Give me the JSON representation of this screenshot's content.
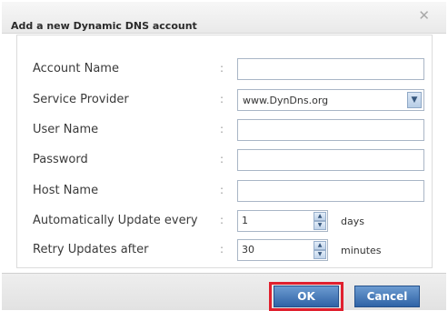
{
  "dialog": {
    "title": "Add a new Dynamic DNS account",
    "close_label": "✕"
  },
  "form": {
    "colon": ":",
    "fields": [
      {
        "label": "Account Name",
        "value": "",
        "type": "text"
      },
      {
        "label": "Service Provider",
        "value": "www.DynDns.org",
        "type": "select"
      },
      {
        "label": "User Name",
        "value": "",
        "type": "text"
      },
      {
        "label": "Password",
        "value": "",
        "type": "password"
      },
      {
        "label": "Host Name",
        "value": "",
        "type": "text"
      }
    ],
    "update_every": {
      "label": "Automatically Update every",
      "value": "1",
      "unit": "days"
    },
    "retry_after": {
      "label": "Retry Updates after",
      "value": "30",
      "unit": "minutes"
    }
  },
  "footer": {
    "ok_label": "OK",
    "cancel_label": "Cancel"
  },
  "colors": {
    "button_blue": "#2f63a6",
    "highlight_red": "#e0202e"
  },
  "icons": {
    "select_arrow": "chevron-down-icon",
    "spin_up": "chevron-up-icon",
    "spin_down": "chevron-down-icon",
    "close": "close-icon"
  }
}
